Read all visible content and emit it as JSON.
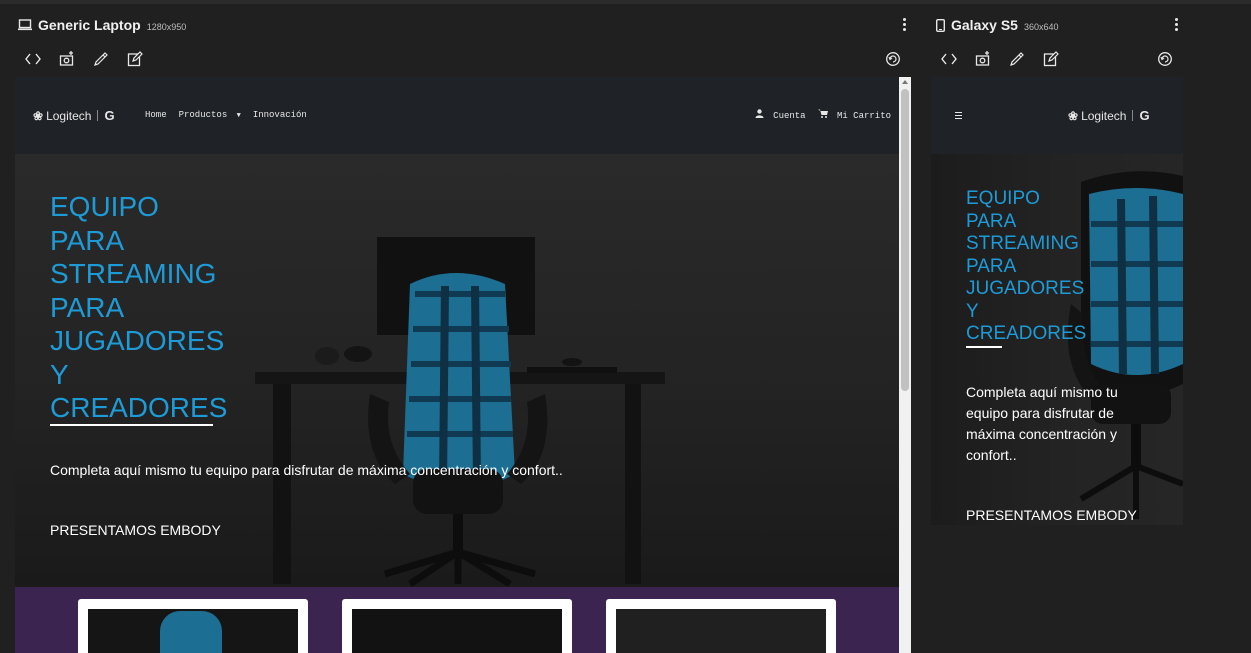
{
  "laptop_panel": {
    "title": "Generic Laptop",
    "resolution": "1280x950"
  },
  "mobile_panel": {
    "title": "Galaxy S5",
    "resolution": "360x640"
  },
  "site": {
    "logo_text": "Logitech",
    "logo_g": "G",
    "nav": {
      "home": "Home",
      "products": "Productos",
      "innovation": "Innovación",
      "account": "Cuenta",
      "cart": "Mi Carrito"
    },
    "hero": {
      "title_lines": [
        "EQUIPO",
        "PARA",
        "STREAMING",
        "PARA",
        "JUGADORES",
        "Y",
        "CREADORES"
      ],
      "description": "Completa aquí mismo tu equipo para disfrutar de máxima concentración y confort..",
      "cta": "PRESENTAMOS EMBODY"
    }
  },
  "colors": {
    "accent_blue": "#1e9bd7",
    "nav_bg": "#1f2226",
    "promo_purple": "#3b2550",
    "chair_blue": "#1c6e93"
  },
  "icons": {
    "laptop": "laptop-icon",
    "phone": "phone-icon",
    "code": "code-icon",
    "screenshot": "camera-icon",
    "eyedropper": "eyedropper-icon",
    "edit": "edit-icon",
    "refresh": "refresh-icon",
    "menu": "hamburger-icon",
    "user": "user-icon",
    "cart": "cart-icon",
    "caret": "caret-down-icon"
  }
}
